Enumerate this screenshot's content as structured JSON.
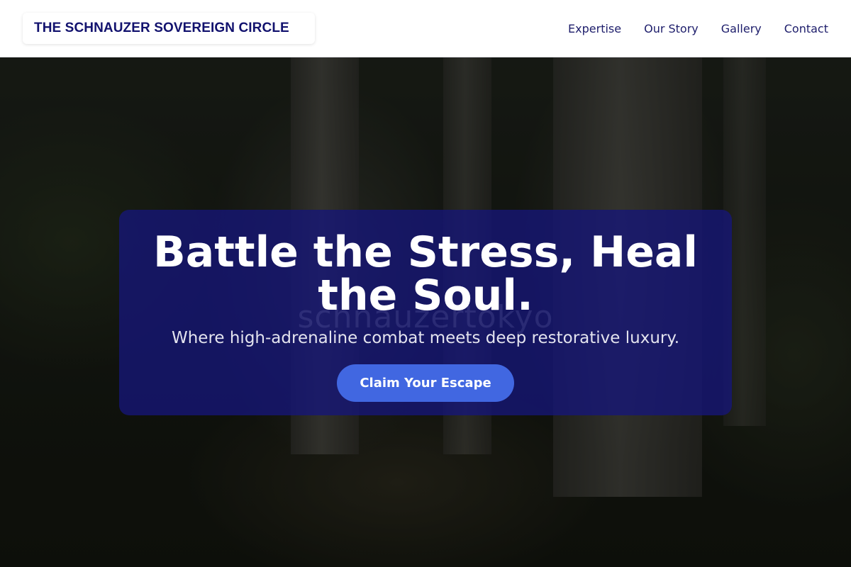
{
  "header": {
    "brand": "THE SCHNAUZER SOVEREIGN CIRCLE",
    "nav": [
      "Expertise",
      "Our Story",
      "Gallery",
      "Contact"
    ]
  },
  "hero": {
    "headline": "Battle the Stress, Heal the Soul.",
    "subheadline": "Where high-adrenaline combat meets deep restorative luxury.",
    "cta_label": "Claim Your Escape",
    "watermark": "schnauzertokyo"
  },
  "colors": {
    "brand_text": "#12126e",
    "nav_text": "#1d1d6b",
    "card_bg": "#16167a",
    "cta_bg": "#4167e1"
  }
}
